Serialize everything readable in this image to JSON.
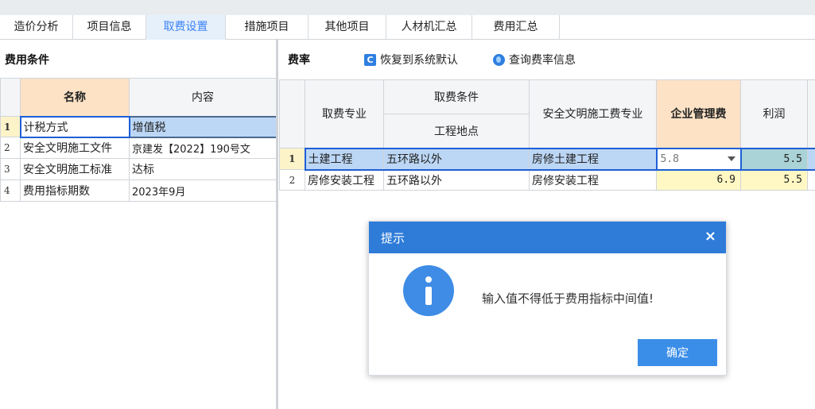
{
  "tabs": [
    {
      "label": "造价分析"
    },
    {
      "label": "项目信息"
    },
    {
      "label": "取费设置"
    },
    {
      "label": "措施项目"
    },
    {
      "label": "其他项目"
    },
    {
      "label": "人材机汇总"
    },
    {
      "label": "费用汇总"
    }
  ],
  "active_tab": "取费设置",
  "left_panel": {
    "title": "费用条件",
    "headers": {
      "name": "名称",
      "content": "内容"
    },
    "rows": [
      {
        "num": "1",
        "name": "计税方式",
        "content": "增值税"
      },
      {
        "num": "2",
        "name": "安全文明施工文件",
        "content": "京建发【2022】190号文"
      },
      {
        "num": "3",
        "name": "安全文明施工标准",
        "content": "达标"
      },
      {
        "num": "4",
        "name": "费用指标期数",
        "content": "2023年9月"
      }
    ]
  },
  "right_panel": {
    "title": "费率",
    "restore_button": "恢复到系统默认",
    "query_button": "查询费率信息",
    "headers": {
      "specialty": "取费专业",
      "condition": "取费条件",
      "location": "工程地点",
      "safety_specialty": "安全文明施工费专业",
      "management_fee": "企业管理费",
      "profit": "利润"
    },
    "rows": [
      {
        "num": "1",
        "specialty": "土建工程",
        "location": "五环路以外",
        "safety_specialty": "房修土建工程",
        "management_fee": "5.8",
        "profit": "5.5"
      },
      {
        "num": "2",
        "specialty": "房修安装工程",
        "location": "五环路以外",
        "safety_specialty": "房修安装工程",
        "management_fee": "6.9",
        "profit": "5.5"
      }
    ]
  },
  "dialog": {
    "title": "提示",
    "close_symbol": "×",
    "message": "输入值不得低于费用指标中间值!",
    "ok_button": "确定"
  },
  "colors": {
    "accent": "#2e7bd8",
    "selection": "#bcd7f5",
    "header_selected": "#fde2c6",
    "yellow_cell": "#fff8c4",
    "teal_cell": "#a9d3d6"
  }
}
